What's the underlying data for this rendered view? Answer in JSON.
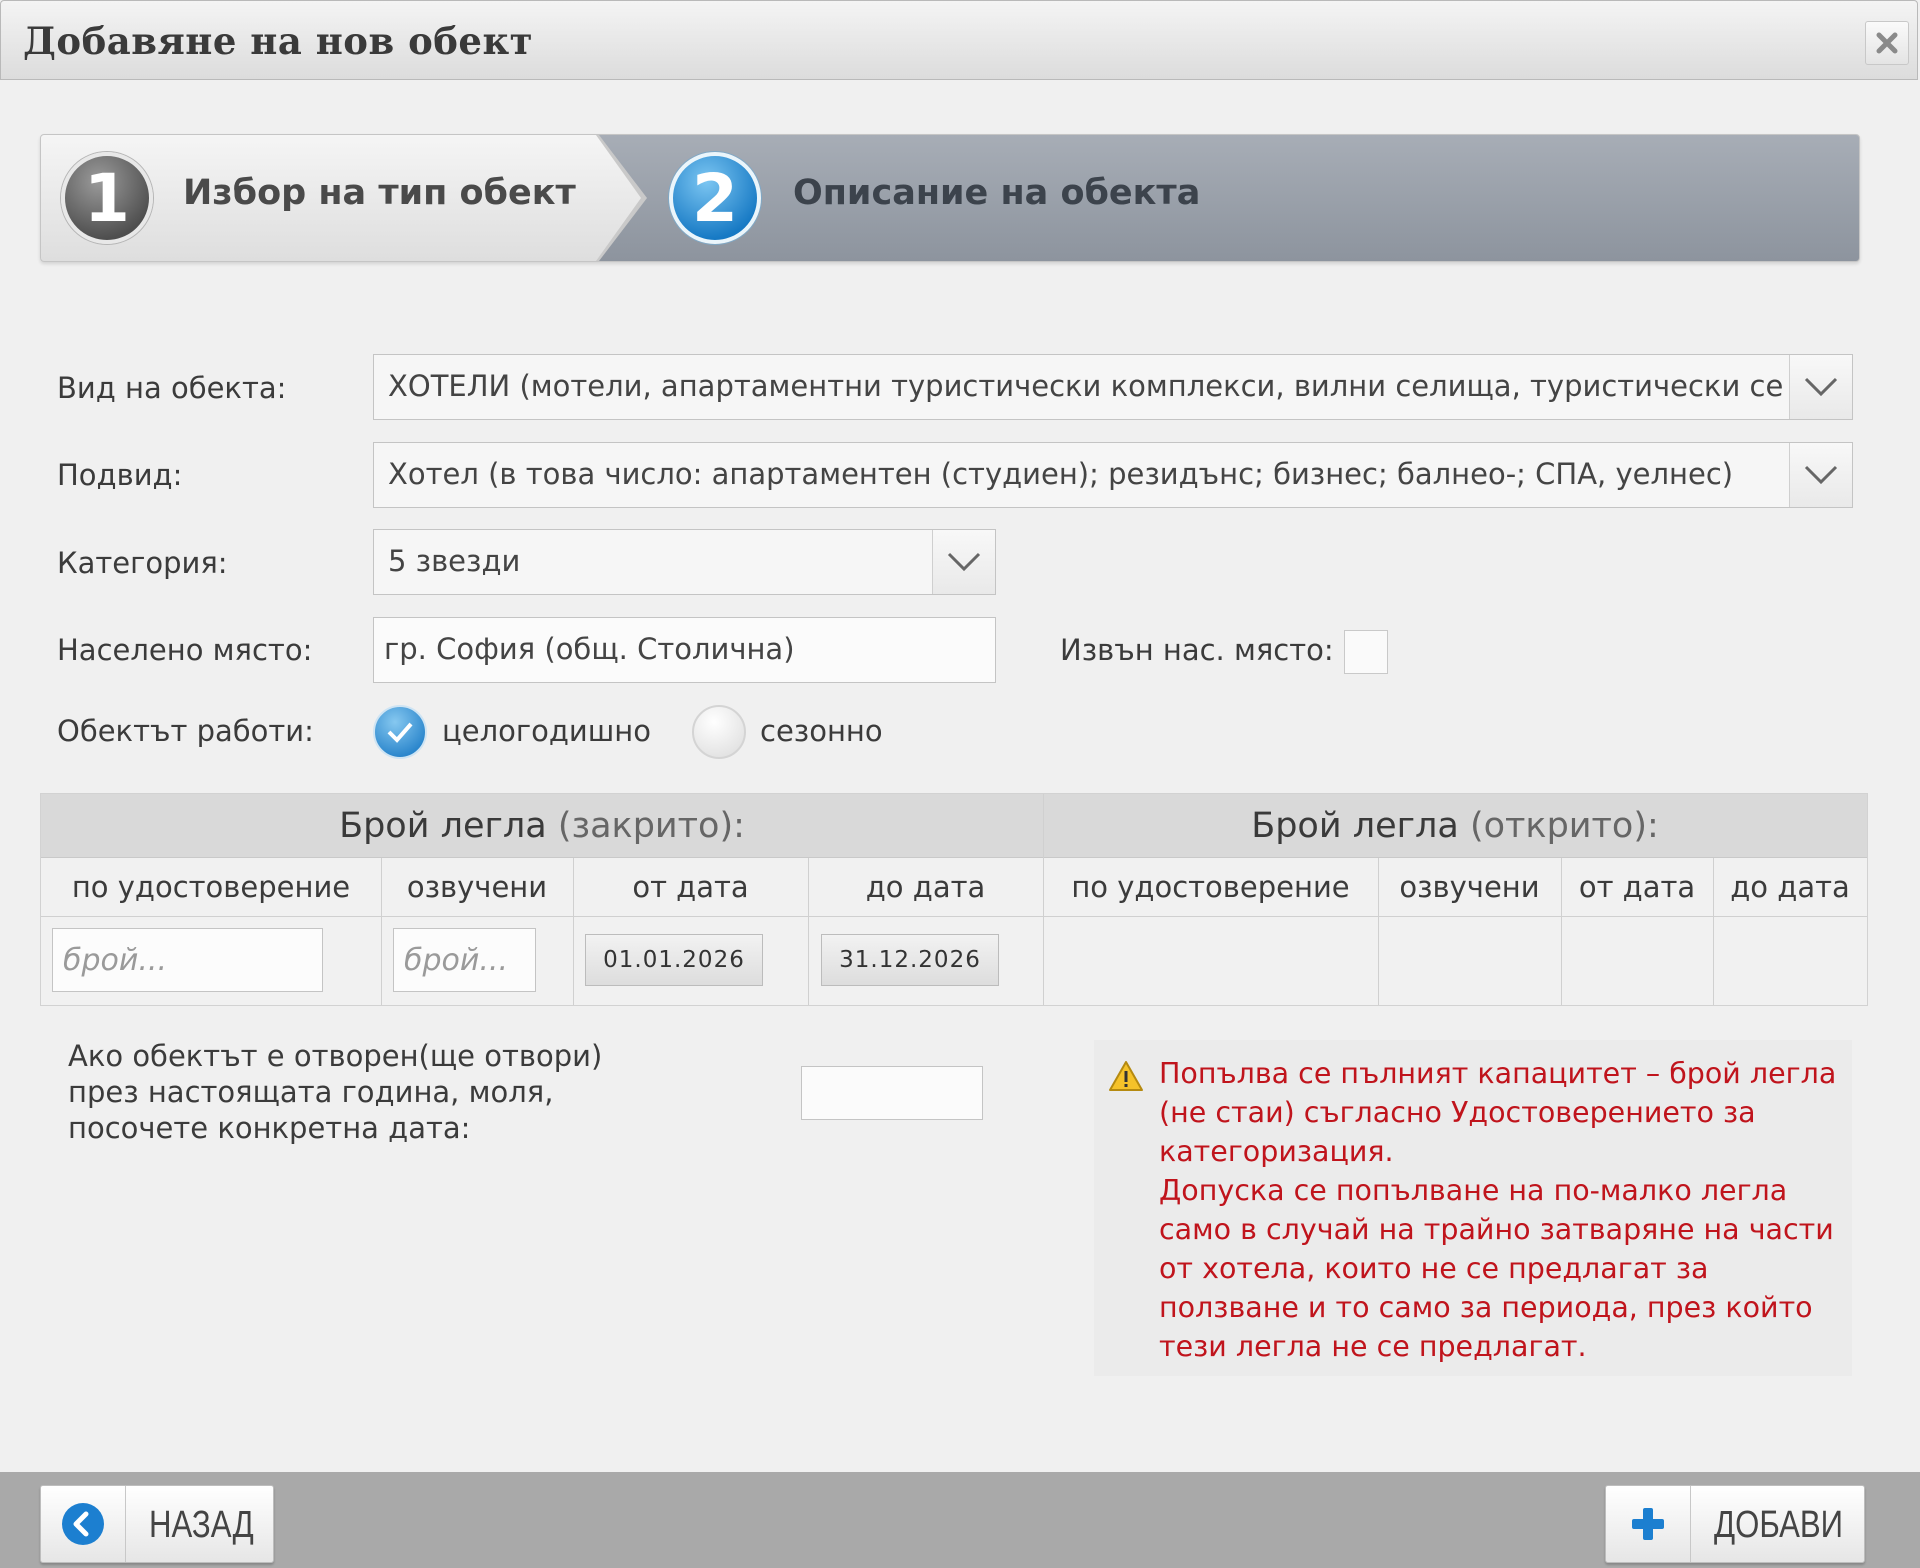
{
  "dialog": {
    "title": "Добавяне на нов обект"
  },
  "wizard": {
    "steps": [
      {
        "number": "1",
        "label": "Избор на тип обект"
      },
      {
        "number": "2",
        "label": "Описание на обекта"
      }
    ]
  },
  "form": {
    "type": {
      "label": "Вид на обекта:",
      "value": "ХОТЕЛИ (мотели, апартаментни туристически комплекси, вилни селища, туристически селища"
    },
    "subtype": {
      "label": "Подвид:",
      "value": "Хотел (в това число: апартаментен (студиен); резидънс; бизнес; балнео-; СПА, уелнес)"
    },
    "category": {
      "label": "Категория:",
      "value": "5 звезди"
    },
    "settlement": {
      "label": "Населено място:",
      "value": "гр. София (общ. Столична)"
    },
    "outside": {
      "label": "Извън нас. място:"
    },
    "operation": {
      "label": "Обектът работи:",
      "options": [
        {
          "label": "целогодишно",
          "selected": true
        },
        {
          "label": "сезонно",
          "selected": false
        }
      ]
    }
  },
  "beds": {
    "closed": {
      "title": "Брой легла",
      "paren": "(закрито):"
    },
    "open": {
      "title": "Брой легла",
      "paren": "(открито):"
    },
    "columns": {
      "certificate": "по удостоверение",
      "voiced": "озвучени",
      "from": "от дата",
      "to": "до дата"
    },
    "placeholder": "брой...",
    "from_date": "01.01.2026",
    "to_date": "31.12.2026"
  },
  "opening": {
    "label": "Ако обектът е отворен(ще отвори) през настоящата година, моля, посочете конкретна дата:"
  },
  "notice": {
    "text1": "Попълва се пълният капацитет – брой легла (не стаи) съгласно Удостоверението за категоризация.",
    "text2": "Допуска се попълване на по-малко легла само в случай на трайно затваряне на части от хотела, които не се предлагат за ползване и то само за периода, през който тези легла не се предлагат.",
    "color": "#c0141c"
  },
  "footer": {
    "back": "НАЗАД",
    "add": "ДОБАВИ"
  }
}
